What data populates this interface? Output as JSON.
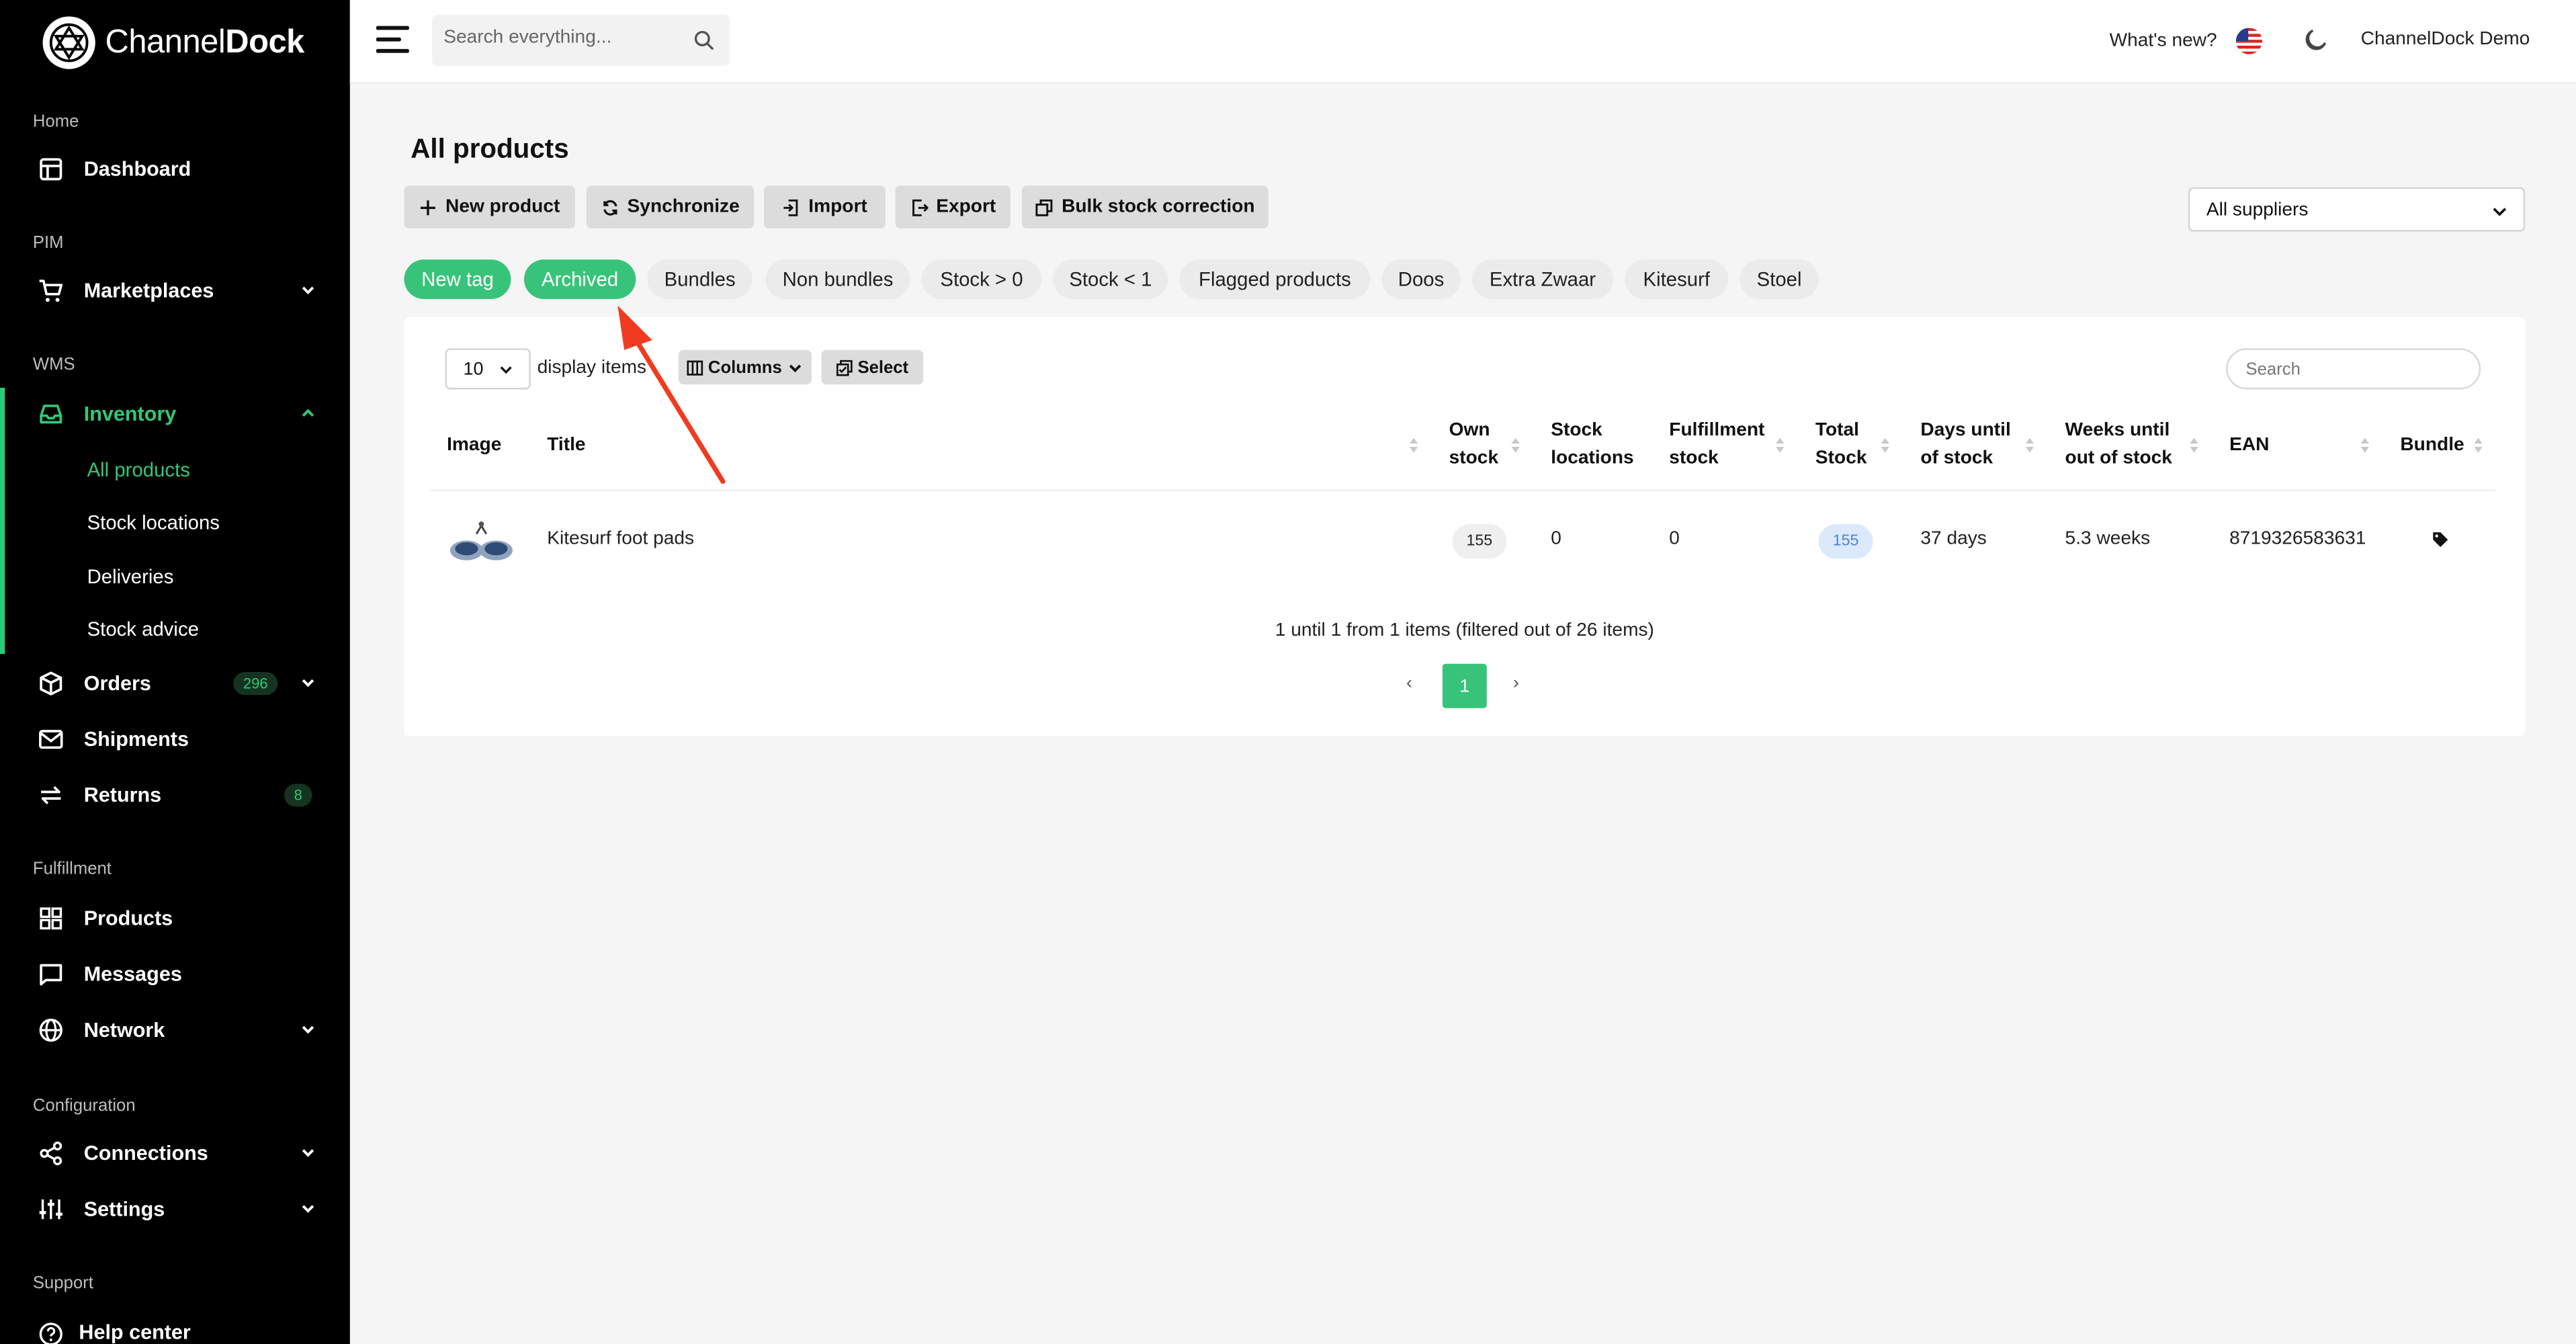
{
  "brand": {
    "name_light": "Channel",
    "name_bold": "Dock",
    "accent": "#37c47a"
  },
  "topbar": {
    "search_placeholder": "Search everything...",
    "whats_new": "What's new?",
    "user": "ChannelDock Demo",
    "icons": [
      "hamburger-icon",
      "search-icon",
      "us-flag-icon",
      "moon-icon"
    ]
  },
  "sidebar": {
    "sections": {
      "home": "Home",
      "pim": "PIM",
      "wms": "WMS",
      "fulfillment": "Fulfillment",
      "configuration": "Configuration",
      "support": "Support"
    },
    "items": {
      "dashboard": "Dashboard",
      "marketplaces": "Marketplaces",
      "inventory": "Inventory",
      "orders": "Orders",
      "orders_badge": "296",
      "shipments": "Shipments",
      "returns": "Returns",
      "returns_badge": "8",
      "products": "Products",
      "messages": "Messages",
      "network": "Network",
      "connections": "Connections",
      "settings": "Settings",
      "help_center": "Help center"
    },
    "inventory_sub": {
      "all_products": "All products",
      "stock_locations": "Stock locations",
      "deliveries": "Deliveries",
      "stock_advice": "Stock advice"
    }
  },
  "page": {
    "title": "All products",
    "buttons": {
      "new_product": "New product",
      "synchronize": "Synchronize",
      "import": "Import",
      "export": "Export",
      "bulk_stock": "Bulk stock correction"
    },
    "supplier_filter": "All suppliers",
    "tags": [
      "New tag",
      "Archived",
      "Bundles",
      "Non bundles",
      "Stock > 0",
      "Stock < 1",
      "Flagged products",
      "Doos",
      "Extra Zwaar",
      "Kitesurf",
      "Stoel"
    ]
  },
  "table": {
    "page_length": "10",
    "display_items": "display items",
    "columns_btn": "Columns",
    "select_btn": "Select",
    "search_placeholder": "Search",
    "headers": {
      "image": "Image",
      "title": "Title",
      "own_stock_1": "Own",
      "own_stock_2": "stock",
      "stock_loc_1": "Stock",
      "stock_loc_2": "locations",
      "fulfil_1": "Fulfillment",
      "fulfil_2": "stock",
      "total_1": "Total",
      "total_2": "Stock",
      "days_1": "Days until",
      "days_2": "of stock",
      "weeks_1": "Weeks until",
      "weeks_2": "out of stock",
      "ean": "EAN",
      "bundle": "Bundle"
    },
    "rows": [
      {
        "title": "Kitesurf foot pads",
        "own_stock": "155",
        "stock_locations": "0",
        "fulfillment_stock": "0",
        "total_stock": "155",
        "days_until": "37 days",
        "weeks_until": "5.3 weeks",
        "ean": "8719326583631",
        "bundle_icon": "tag-icon"
      }
    ],
    "info": "1 until 1 from 1 items (filtered out of 26 items)",
    "pagination": {
      "prev": "‹",
      "current": "1",
      "next": "›"
    }
  }
}
